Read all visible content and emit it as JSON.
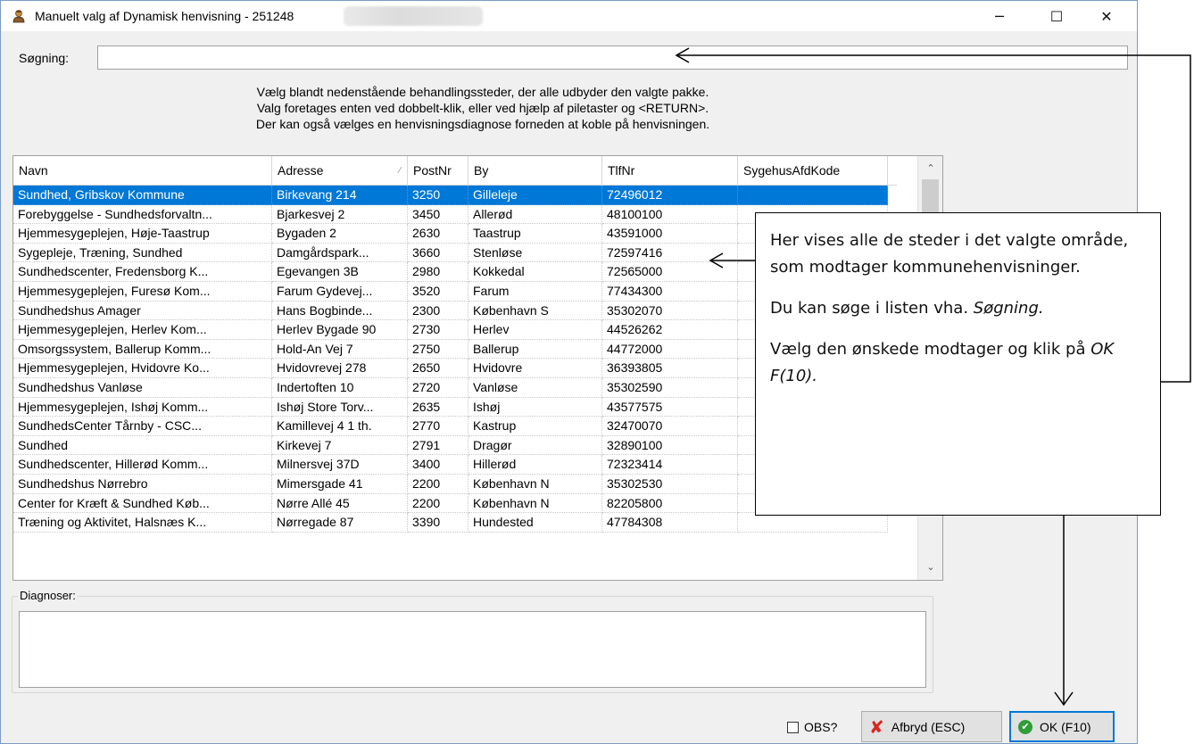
{
  "window": {
    "title": "Manuelt valg af Dynamisk henvisning - 251248",
    "minimize_label": "─",
    "maximize_label": "☐",
    "close_label": "✕",
    "icon": "person-icon"
  },
  "search": {
    "label": "Søgning:",
    "value": ""
  },
  "instructions": {
    "line1": "Vælg blandt nedenstående behandlingssteder, der alle udbyder den valgte pakke.",
    "line2": "Valg foretages enten ved dobbelt-klik, eller ved hjælp af piletaster og <RETURN>.",
    "line3": "Der kan også vælges en henvisningsdiagnose forneden at koble på henvisningen."
  },
  "table": {
    "columns": [
      "Navn",
      "Adresse",
      "PostNr",
      "By",
      "TlfNr",
      "SygehusAfdKode"
    ],
    "sort_icon": "sort-indicator-icon",
    "selected_index": 0,
    "rows": [
      [
        "Sundhed, Gribskov Kommune",
        "Birkevang 214",
        "3250",
        "Gilleleje",
        "72496012",
        ""
      ],
      [
        "Forebyggelse - Sundhedsforvaltn...",
        "Bjarkesvej 2",
        "3450",
        "Allerød",
        "48100100",
        ""
      ],
      [
        "Hjemmesygeplejen, Høje-Taastrup",
        "Bygaden 2",
        "2630",
        "Taastrup",
        "43591000",
        ""
      ],
      [
        "Sygepleje, Træning, Sundhed",
        "Damgårdspark...",
        "3660",
        "Stenløse",
        "72597416",
        ""
      ],
      [
        "Sundhedscenter, Fredensborg K...",
        "Egevangen 3B",
        "2980",
        "Kokkedal",
        "72565000",
        ""
      ],
      [
        "Hjemmesygeplejen, Furesø Kom...",
        "Farum Gydevej...",
        "3520",
        "Farum",
        "77434300",
        ""
      ],
      [
        "Sundhedshus Amager",
        "Hans Bogbinde...",
        "2300",
        "København S",
        "35302070",
        ""
      ],
      [
        "Hjemmesygeplejen, Herlev Kom...",
        "Herlev Bygade 90",
        "2730",
        "Herlev",
        "44526262",
        ""
      ],
      [
        "Omsorgssystem, Ballerup Komm...",
        "Hold-An Vej 7",
        "2750",
        "Ballerup",
        "44772000",
        ""
      ],
      [
        "Hjemmesygeplejen, Hvidovre Ko...",
        "Hvidovrevej 278",
        "2650",
        "Hvidovre",
        "36393805",
        ""
      ],
      [
        "Sundhedshus Vanløse",
        "Indertoften 10",
        "2720",
        "Vanløse",
        "35302590",
        ""
      ],
      [
        "Hjemmesygeplejen, Ishøj Komm...",
        "Ishøj Store Torv...",
        "2635",
        "Ishøj",
        "43577575",
        ""
      ],
      [
        "SundhedsCenter Tårnby - CSC...",
        "Kamillevej 4 1 th.",
        "2770",
        "Kastrup",
        "32470070",
        ""
      ],
      [
        "Sundhed",
        "Kirkevej 7",
        "2791",
        "Dragør",
        "32890100",
        ""
      ],
      [
        "Sundhedscenter, Hillerød Komm...",
        "Milnersvej 37D",
        "3400",
        "Hillerød",
        "72323414",
        ""
      ],
      [
        "Sundhedshus Nørrebro",
        "Mimersgade 41",
        "2200",
        "København N",
        "35302530",
        ""
      ],
      [
        "Center for Kræft & Sundhed Køb...",
        "Nørre Allé 45",
        "2200",
        "København N",
        "82205800",
        ""
      ],
      [
        "Træning og Aktivitet, Halsnæs K...",
        "Nørregade 87",
        "3390",
        "Hundested",
        "47784308",
        ""
      ]
    ]
  },
  "diagnoser": {
    "label": "Diagnoser:",
    "value": ""
  },
  "footer": {
    "obs_label": "OBS?",
    "obs_checked": false,
    "cancel_label": "Afbryd (ESC)",
    "ok_label": "OK (F10)",
    "cancel_icon": "cancel-x-icon",
    "ok_icon": "ok-check-icon"
  },
  "callout": {
    "p1": "Her vises alle de steder i det valgte område, som modtager kommunehenvisninger.",
    "p2_prefix": "Du kan søge i listen vha. ",
    "p2_em": "Søgning.",
    "p3_prefix": "Vælg den ønskede modtager og klik på ",
    "p3_em": "OK F(10)."
  },
  "colors": {
    "selection": "#0078d7",
    "window_bg": "#f0f0f0",
    "cancel_icon": "#d7261e",
    "ok_icon": "#2f9e3a"
  }
}
